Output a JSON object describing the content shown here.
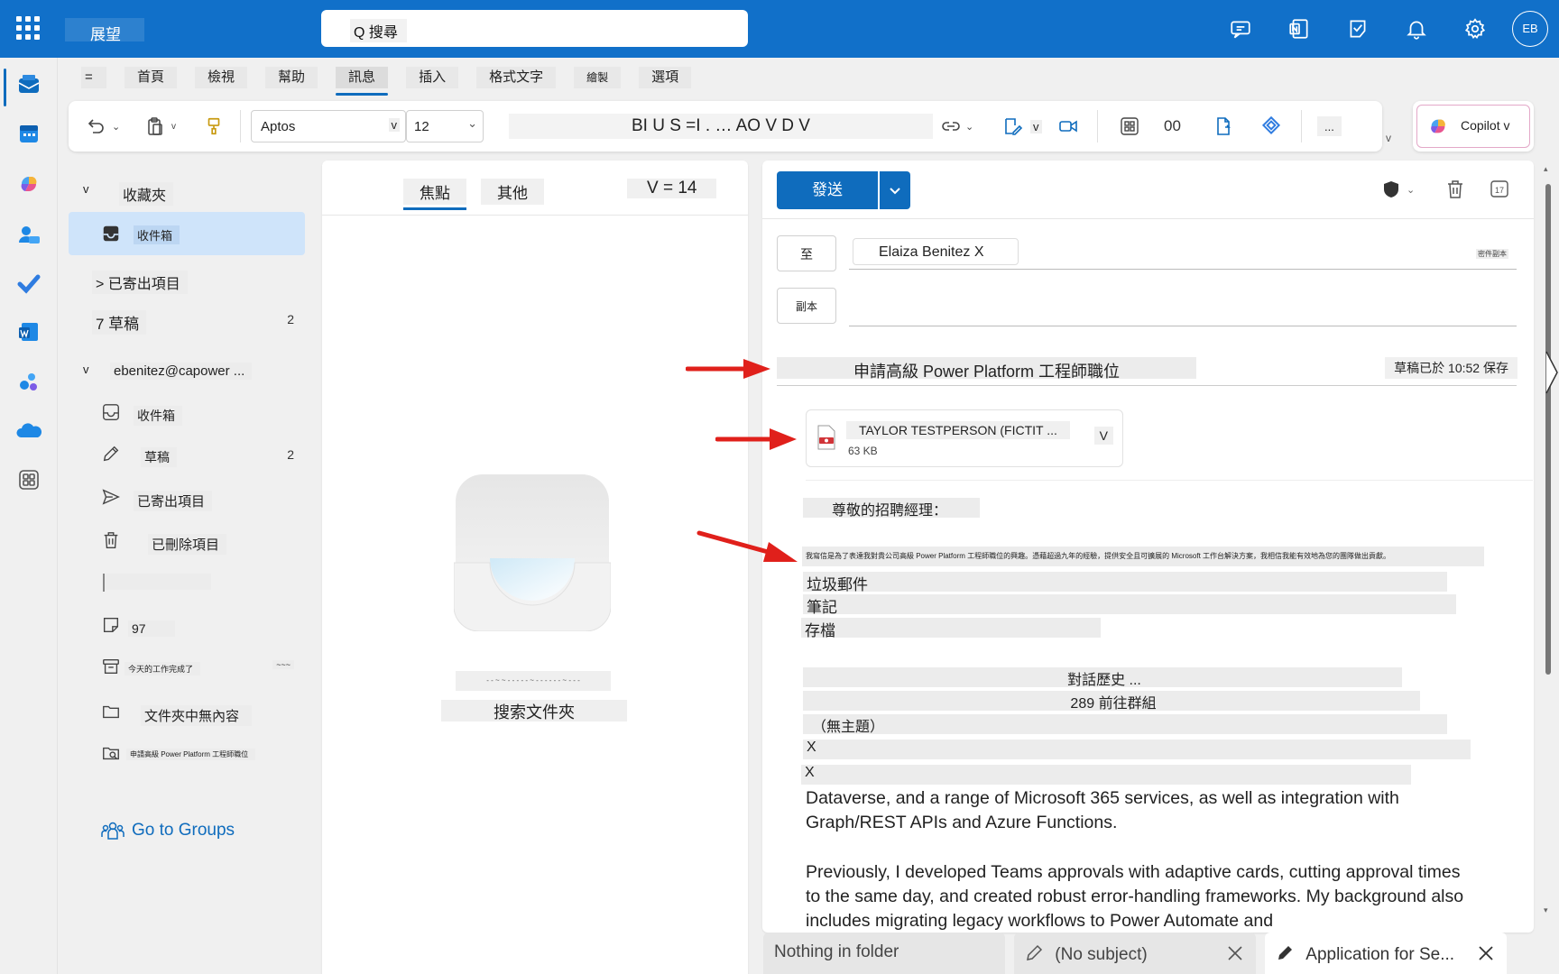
{
  "app": {
    "title": "展望"
  },
  "search": {
    "label": "Q 搜尋"
  },
  "user": {
    "initials": "EB"
  },
  "topbar_icons": [
    "teams-chat-icon",
    "onenote-icon",
    "todo-note-icon",
    "bell-icon",
    "gear-icon"
  ],
  "tabs": [
    "首頁",
    "檢視",
    "幫助",
    "訊息",
    "插入",
    "格式文字",
    "繪製",
    "選項"
  ],
  "active_tab": "訊息",
  "toolbar": {
    "font": "Aptos",
    "font_dropdown": "v",
    "size": "12",
    "format_text": "BI U S =I . … AO V D V",
    "picture_label": "v",
    "number_label": "00",
    "more": "...",
    "expand": "v",
    "copilot_label": "Copilot v"
  },
  "folders": {
    "favorites_toggle": "v",
    "favorites_label": "收藏夾",
    "favorites": [
      {
        "label": "收件箱",
        "count": "",
        "selected": true
      },
      {
        "label": "> 已寄出項目",
        "count": ""
      },
      {
        "label": "7 草稿",
        "count": "2"
      }
    ],
    "account_toggle": "v",
    "account_label": "ebenitez@capower ...",
    "account_folders": [
      {
        "label": "收件箱",
        "count": "",
        "icon": "inbox-icon"
      },
      {
        "label": "草稿",
        "count": "2",
        "icon": "pencil-icon"
      },
      {
        "label": "已寄出項目",
        "count": "",
        "icon": "send-icon"
      },
      {
        "label": "已刪除項目",
        "count": "",
        "icon": "trash-icon"
      },
      {
        "label": "",
        "count": "",
        "icon": "folder-partial-icon"
      },
      {
        "label": "97",
        "count": "",
        "icon": "note-icon"
      },
      {
        "label": "今天的工作完成了",
        "count": "~~~",
        "icon": "archive-icon"
      },
      {
        "label": "文件夾中無內容",
        "count": "",
        "icon": "folder-icon"
      },
      {
        "label": "申請高級 Power Platform 工程師職位",
        "count": "",
        "icon": "search-folder-icon"
      }
    ],
    "go_to_groups": "Go to Groups"
  },
  "message_list": {
    "tabs": [
      "焦點",
      "其他"
    ],
    "filter": "V = 14",
    "empty_small": "- - ~ ~ - - - - - ~ - - - - - - ~ - - -",
    "empty_button": "搜索文件夾"
  },
  "compose": {
    "send_label": "發送",
    "to_label": "至",
    "cc_label": "副本",
    "recipient": "Elaiza Benitez X",
    "cc_bcc_hint": "密件副本",
    "subject": "申請高級 Power Platform 工程師職位",
    "saved": "草稿已於 10:52 保存",
    "attachment": {
      "name": "TAYLOR TESTPERSON (FICTIT ...",
      "size": "63 KB",
      "menu": "V"
    },
    "greeting": "尊敬的招聘經理：",
    "intro": "我寫信是為了表達我對貴公司高級 Power Platform 工程師職位的興趣。憑藉超過九年的經驗，提供安全且可擴展的 Microsoft 工作台解決方案，我相信我能有效地為您的團隊做出貢獻。",
    "lines": [
      "垃圾郵件",
      "筆記",
      "存檔"
    ],
    "history_lines": [
      "對話歷史 ...",
      "289 前往群組",
      "（無主題）",
      "X",
      "X"
    ],
    "paragraph1": "Dataverse, and a range of Microsoft 365 services, as well as integration with Graph/REST APIs and Azure Functions.",
    "paragraph2": "Previously, I developed Teams approvals with adaptive cards, cutting approval times to the same day, and created robust error-handling frameworks. My background also includes migrating legacy workflows to Power Automate and"
  },
  "bottom_tabs": [
    "Nothing in folder",
    "(No subject)",
    "Application for Se..."
  ],
  "colors": {
    "brand": "#1170c9",
    "accent": "#0f6cbd",
    "arrow": "#e0201b",
    "selected": "#cfe4fa"
  }
}
